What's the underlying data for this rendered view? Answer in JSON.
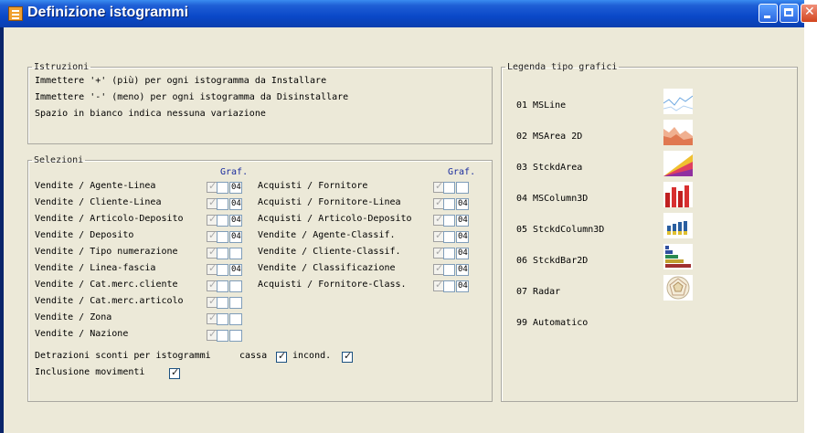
{
  "window": {
    "title": "Definizione istogrammi"
  },
  "istruzioni": {
    "legend": "Istruzioni",
    "lines": [
      "Immettere '+' (più) per ogni istogramma da Installare",
      "Immettere '-' (meno) per ogni istogramma da Disinstallare",
      "Spazio in bianco indica nessuna variazione"
    ]
  },
  "selezioni": {
    "legend": "Selezioni",
    "graf_label": "Graf.",
    "left": [
      {
        "label": "Vendite / Agente-Linea",
        "checked": true,
        "graf": "04"
      },
      {
        "label": "Vendite / Cliente-Linea",
        "checked": true,
        "graf": "04"
      },
      {
        "label": "Vendite / Articolo-Deposito",
        "checked": true,
        "graf": "04"
      },
      {
        "label": "Vendite / Deposito",
        "checked": true,
        "graf": "04"
      },
      {
        "label": "Vendite / Tipo numerazione",
        "checked": true,
        "graf": ""
      },
      {
        "label": "Vendite / Linea-fascia",
        "checked": true,
        "graf": "04"
      },
      {
        "label": "Vendite / Cat.merc.cliente",
        "checked": true,
        "graf": ""
      },
      {
        "label": "Vendite / Cat.merc.articolo",
        "checked": true,
        "graf": ""
      },
      {
        "label": "Vendite / Zona",
        "checked": true,
        "graf": ""
      },
      {
        "label": "Vendite / Nazione",
        "checked": true,
        "graf": ""
      }
    ],
    "right": [
      {
        "label": "Acquisti / Fornitore",
        "checked": true,
        "graf": ""
      },
      {
        "label": "Acquisti / Fornitore-Linea",
        "checked": true,
        "graf": "04"
      },
      {
        "label": "Acquisti / Articolo-Deposito",
        "checked": true,
        "graf": "04"
      },
      {
        "label": "Vendite / Agente-Classif.",
        "checked": true,
        "graf": "04"
      },
      {
        "label": "Vendite / Cliente-Classif.",
        "checked": true,
        "graf": "04"
      },
      {
        "label": "Vendite / Classificazione",
        "checked": true,
        "graf": "04"
      },
      {
        "label": "Acquisti / Fornitore-Class.",
        "checked": true,
        "graf": "04"
      }
    ],
    "detrazioni_label": "Detrazioni sconti per istogrammi",
    "cassa_label": "cassa",
    "cassa_checked": true,
    "incond_label": "incond.",
    "incond_checked": true,
    "inclusione_label": "Inclusione movimenti",
    "inclusione_checked": true
  },
  "legenda": {
    "legend": "Legenda tipo grafici",
    "items": [
      {
        "label": "01 MSLine",
        "icon": "line-chart-icon"
      },
      {
        "label": "02 MSArea 2D",
        "icon": "area-chart-icon"
      },
      {
        "label": "03 StckdArea",
        "icon": "stacked-area-chart-icon"
      },
      {
        "label": "04 MSColumn3D",
        "icon": "column-3d-chart-icon"
      },
      {
        "label": "05 StckdColumn3D",
        "icon": "stacked-column-3d-chart-icon"
      },
      {
        "label": "06 StckdBar2D",
        "icon": "stacked-bar-chart-icon"
      },
      {
        "label": "07 Radar",
        "icon": "radar-chart-icon"
      },
      {
        "label": "99 Automatico",
        "icon": ""
      }
    ]
  }
}
